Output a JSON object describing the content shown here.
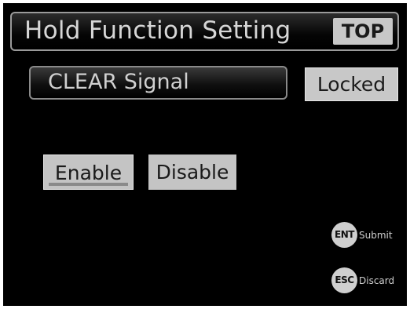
{
  "header": {
    "title": "Hold Function Setting",
    "top_label": "TOP"
  },
  "parameter": {
    "name": "CLEAR Signal",
    "lock_state": "Locked"
  },
  "options": [
    {
      "label": "Enable",
      "selected": true
    },
    {
      "label": "Disable",
      "selected": false
    }
  ],
  "keys": [
    {
      "key": "ENT",
      "action": "Submit"
    },
    {
      "key": "ESC",
      "action": "Discard"
    }
  ]
}
